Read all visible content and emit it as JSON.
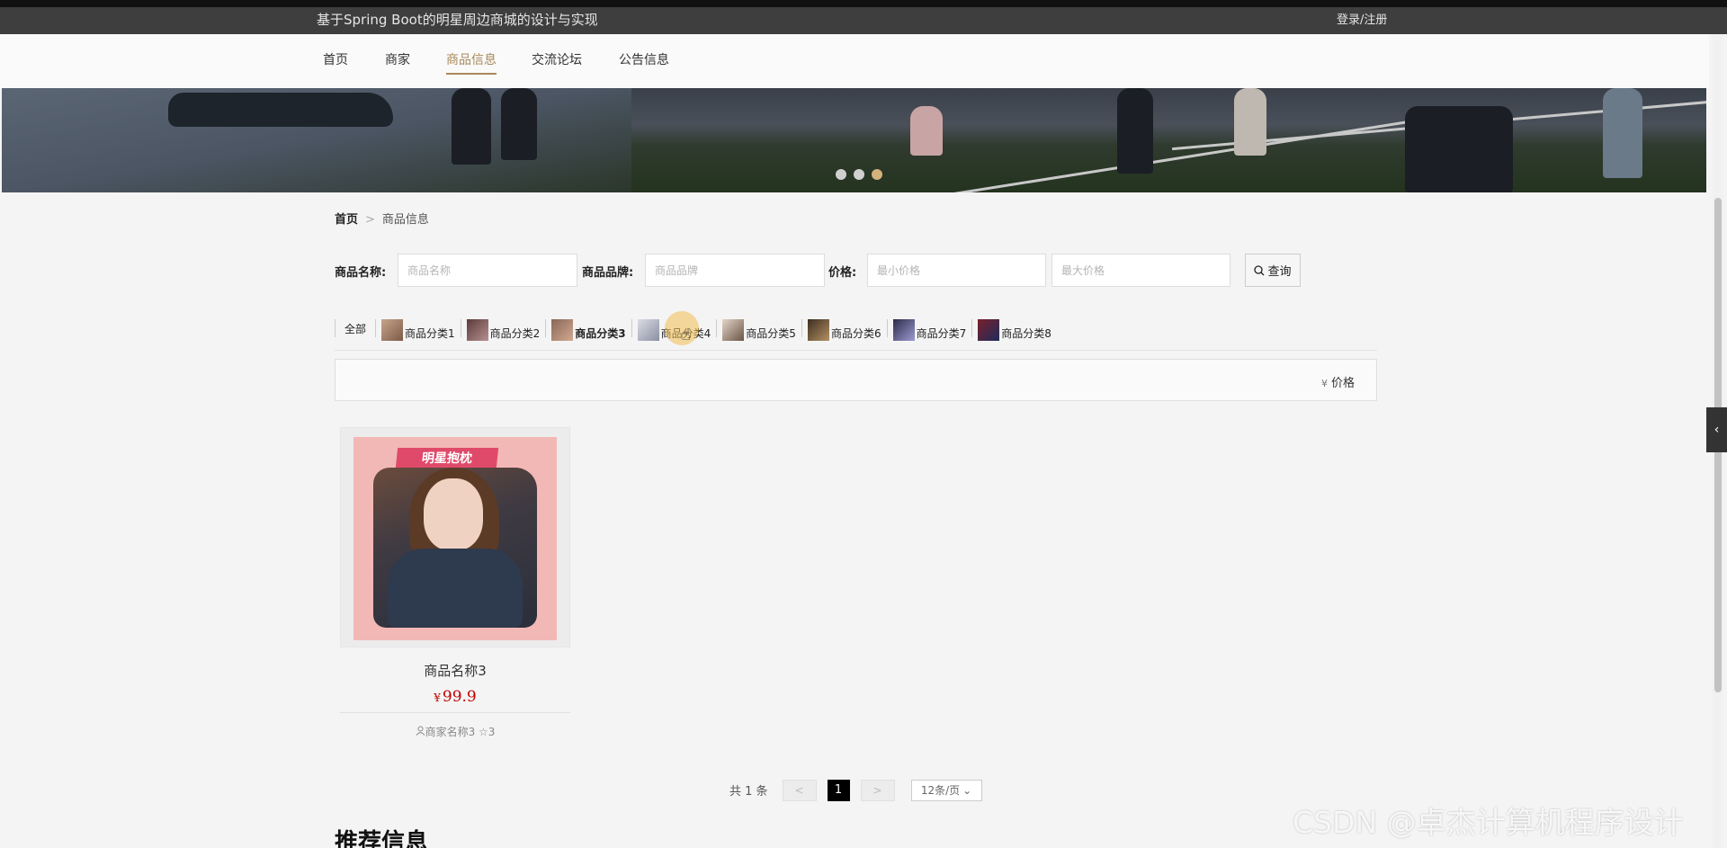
{
  "header": {
    "site_title": "基于Spring Boot的明星周边商城的设计与实现",
    "login_label": "登录/注册"
  },
  "nav": {
    "items": [
      {
        "label": "首页"
      },
      {
        "label": "商家"
      },
      {
        "label": "商品信息",
        "active": true
      },
      {
        "label": "交流论坛"
      },
      {
        "label": "公告信息"
      }
    ]
  },
  "banner": {
    "slide_count": 3,
    "active_slide": 3
  },
  "breadcrumb": {
    "home": "首页",
    "separator": ">",
    "current": "商品信息"
  },
  "search": {
    "name_label": "商品名称:",
    "name_placeholder": "商品名称",
    "brand_label": "商品品牌:",
    "brand_placeholder": "商品品牌",
    "price_label": "价格:",
    "min_price_placeholder": "最小价格",
    "max_price_placeholder": "最大价格",
    "search_button": "查询"
  },
  "categories": {
    "all_label": "全部",
    "items": [
      {
        "label": "商品分类1"
      },
      {
        "label": "商品分类2"
      },
      {
        "label": "商品分类3",
        "selected": true
      },
      {
        "label": "商品分类4"
      },
      {
        "label": "商品分类5"
      },
      {
        "label": "商品分类6"
      },
      {
        "label": "商品分类7"
      },
      {
        "label": "商品分类8"
      }
    ]
  },
  "sort": {
    "currency_symbol": "¥",
    "price_label": "价格"
  },
  "products": [
    {
      "image_text": "明星抱枕",
      "name": "商品名称3",
      "currency": "¥",
      "price": "99.9",
      "merchant": "商家名称3",
      "favorites": "3"
    }
  ],
  "pagination": {
    "total_text": "共 1 条",
    "prev": "<",
    "current_page": "1",
    "next": ">",
    "page_size": "12条/页"
  },
  "recommend": {
    "title": "推荐信息"
  },
  "watermark": "CSDN @卓杰计算机程序设计",
  "colors": {
    "accent": "#a88a5c",
    "price": "#c40000",
    "topbar": "#3e3e3e"
  }
}
